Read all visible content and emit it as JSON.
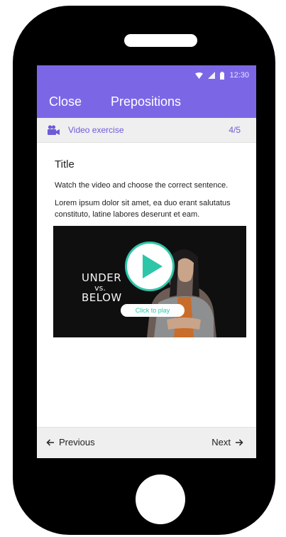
{
  "status_bar": {
    "time": "12:30"
  },
  "app_bar": {
    "close_label": "Close",
    "title": "Prepositions"
  },
  "exercise": {
    "type_label": "Video exercise",
    "progress": "4/5",
    "type_icon": "video-camera-icon"
  },
  "content": {
    "title": "Title",
    "instruction": "Watch the video and choose the correct sentence.",
    "body": "Lorem ipsum dolor sit amet, ea duo erant salutatus constituto, latine labores deserunt et eam."
  },
  "video": {
    "caption_line1": "UNDER",
    "caption_line2": "vs.",
    "caption_line3": "BELOW",
    "play_label": "Click to play"
  },
  "navigation": {
    "previous_label": "Previous",
    "next_label": "Next"
  },
  "colors": {
    "primary": "#7B67E6",
    "accent": "#2DC6A8",
    "subheader_bg": "#efefef"
  }
}
